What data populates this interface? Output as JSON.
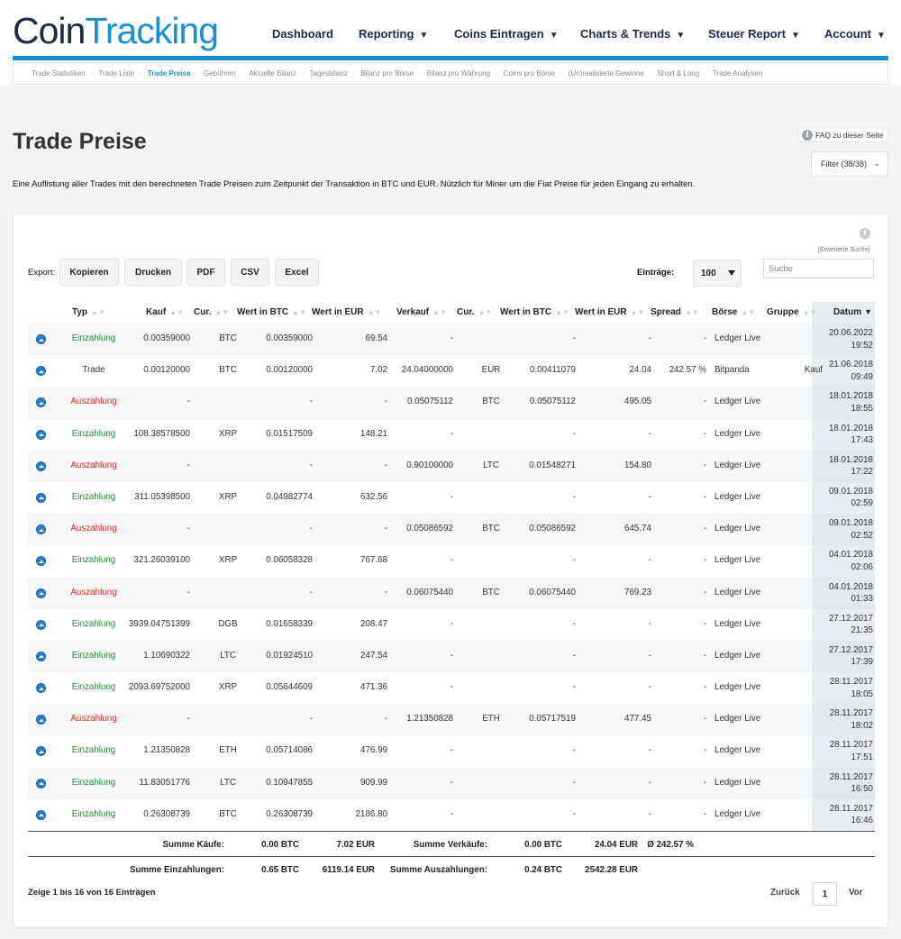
{
  "logo": {
    "part1": "Coin",
    "part2": "Tracking"
  },
  "nav": [
    {
      "label": "Dashboard",
      "caret": ""
    },
    {
      "label": "Reporting",
      "caret": "▼"
    },
    {
      "label": "Coins Eintragen",
      "caret": "▼"
    },
    {
      "label": "Charts & Trends",
      "caret": "▼"
    },
    {
      "label": "Steuer Report",
      "caret": "▼"
    },
    {
      "label": "Account",
      "caret": "▼"
    }
  ],
  "subnav": [
    "Trade Statistiken",
    "Trade Liste",
    "Trade Preise",
    "Gebühren",
    "Aktuelle Bilanz",
    "Tagesbilanz",
    "Bilanz pro Börse",
    "Bilanz pro Währung",
    "Coins pro Börse",
    "(Un)realisierte Gewinne",
    "Short & Long",
    "Trade Analysen"
  ],
  "subnav_active": "Trade Preise",
  "page": {
    "title": "Trade Preise",
    "faq": "FAQ zu dieser Seite",
    "filter": "Filter (38/38)",
    "description": "Eine Auflistung aller Trades mit den berechneten Trade Preisen zum Zeitpunkt der Transaktion in BTC und EUR. Nützlich für Miner um die Fiat Preise für jeden Eingang zu erhalten."
  },
  "toolbar": {
    "export_label": "Export:",
    "buttons": [
      "Kopieren",
      "Drucken",
      "PDF",
      "CSV",
      "Excel"
    ],
    "entries_label": "Einträge:",
    "entries_value": "100",
    "adv_search": "[Erweiterte Suche]",
    "search_placeholder": "Suche"
  },
  "table": {
    "headers": [
      "Typ",
      "Kauf",
      "Cur.",
      "Wert in BTC",
      "Wert in EUR",
      "Verkauf",
      "Cur.",
      "Wert in BTC",
      "Wert in EUR",
      "Spread",
      "Börse",
      "Gruppe",
      "Datum"
    ],
    "rows": [
      {
        "typ": "Einzahlung",
        "kind": "in",
        "kauf": "0.00359000",
        "kcur": "BTC",
        "kbtc": "0.00359000",
        "keur": "69.54",
        "verkauf": "-",
        "vcur": "",
        "vbtc": "-",
        "veur": "-",
        "spread": "-",
        "boerse": "Ledger Live",
        "gruppe": "",
        "date": "20.06.2022",
        "time": "19:52"
      },
      {
        "typ": "Trade",
        "kind": "trade",
        "kauf": "0.00120000",
        "kcur": "BTC",
        "kbtc": "0.00120000",
        "keur": "7.02",
        "verkauf": "24.04000000",
        "vcur": "EUR",
        "vbtc": "0.00411079",
        "veur": "24.04",
        "spread": "242.57 %",
        "boerse": "Bitpanda",
        "gruppe": "Kauf",
        "date": "21.06.2018",
        "time": "09:49"
      },
      {
        "typ": "Auszahlung",
        "kind": "out",
        "kauf": "-",
        "kcur": "",
        "kbtc": "-",
        "keur": "-",
        "verkauf": "0.05075112",
        "vcur": "BTC",
        "vbtc": "0.05075112",
        "veur": "495.05",
        "spread": "-",
        "boerse": "Ledger Live",
        "gruppe": "",
        "date": "18.01.2018",
        "time": "18:55"
      },
      {
        "typ": "Einzahlung",
        "kind": "in",
        "kauf": "108.38578500",
        "kcur": "XRP",
        "kbtc": "0.01517509",
        "keur": "148.21",
        "verkauf": "-",
        "vcur": "",
        "vbtc": "-",
        "veur": "-",
        "spread": "-",
        "boerse": "Ledger Live",
        "gruppe": "",
        "date": "18.01.2018",
        "time": "17:43"
      },
      {
        "typ": "Auszahlung",
        "kind": "out",
        "kauf": "-",
        "kcur": "",
        "kbtc": "-",
        "keur": "-",
        "verkauf": "0.90100000",
        "vcur": "LTC",
        "vbtc": "0.01548271",
        "veur": "154.80",
        "spread": "-",
        "boerse": "Ledger Live",
        "gruppe": "",
        "date": "18.01.2018",
        "time": "17:22"
      },
      {
        "typ": "Einzahlung",
        "kind": "in",
        "kauf": "311.05398500",
        "kcur": "XRP",
        "kbtc": "0.04982774",
        "keur": "632.56",
        "verkauf": "-",
        "vcur": "",
        "vbtc": "-",
        "veur": "-",
        "spread": "-",
        "boerse": "Ledger Live",
        "gruppe": "",
        "date": "09.01.2018",
        "time": "02:59"
      },
      {
        "typ": "Auszahlung",
        "kind": "out",
        "kauf": "-",
        "kcur": "",
        "kbtc": "-",
        "keur": "-",
        "verkauf": "0.05086592",
        "vcur": "BTC",
        "vbtc": "0.05086592",
        "veur": "645.74",
        "spread": "-",
        "boerse": "Ledger Live",
        "gruppe": "",
        "date": "09.01.2018",
        "time": "02:52"
      },
      {
        "typ": "Einzahlung",
        "kind": "in",
        "kauf": "321.26039100",
        "kcur": "XRP",
        "kbtc": "0.06058328",
        "keur": "767.68",
        "verkauf": "-",
        "vcur": "",
        "vbtc": "-",
        "veur": "-",
        "spread": "-",
        "boerse": "Ledger Live",
        "gruppe": "",
        "date": "04.01.2018",
        "time": "02:06"
      },
      {
        "typ": "Auszahlung",
        "kind": "out",
        "kauf": "-",
        "kcur": "",
        "kbtc": "-",
        "keur": "-",
        "verkauf": "0.06075440",
        "vcur": "BTC",
        "vbtc": "0.06075440",
        "veur": "769.23",
        "spread": "-",
        "boerse": "Ledger Live",
        "gruppe": "",
        "date": "04.01.2018",
        "time": "01:33"
      },
      {
        "typ": "Einzahlung",
        "kind": "in",
        "kauf": "3939.04751399",
        "kcur": "DGB",
        "kbtc": "0.01658339",
        "keur": "208.47",
        "verkauf": "-",
        "vcur": "",
        "vbtc": "-",
        "veur": "-",
        "spread": "-",
        "boerse": "Ledger Live",
        "gruppe": "",
        "date": "27.12.2017",
        "time": "21:35"
      },
      {
        "typ": "Einzahlung",
        "kind": "in",
        "kauf": "1.10690322",
        "kcur": "LTC",
        "kbtc": "0.01924510",
        "keur": "247.54",
        "verkauf": "-",
        "vcur": "",
        "vbtc": "-",
        "veur": "-",
        "spread": "-",
        "boerse": "Ledger Live",
        "gruppe": "",
        "date": "27.12.2017",
        "time": "17:39"
      },
      {
        "typ": "Einzahlung",
        "kind": "in",
        "kauf": "2093.69752000",
        "kcur": "XRP",
        "kbtc": "0.05644609",
        "keur": "471.36",
        "verkauf": "-",
        "vcur": "",
        "vbtc": "-",
        "veur": "-",
        "spread": "-",
        "boerse": "Ledger Live",
        "gruppe": "",
        "date": "28.11.2017",
        "time": "18:05"
      },
      {
        "typ": "Auszahlung",
        "kind": "out",
        "kauf": "-",
        "kcur": "",
        "kbtc": "-",
        "keur": "-",
        "verkauf": "1.21350828",
        "vcur": "ETH",
        "vbtc": "0.05717519",
        "veur": "477.45",
        "spread": "-",
        "boerse": "Ledger Live",
        "gruppe": "",
        "date": "28.11.2017",
        "time": "18:02"
      },
      {
        "typ": "Einzahlung",
        "kind": "in",
        "kauf": "1.21350828",
        "kcur": "ETH",
        "kbtc": "0.05714086",
        "keur": "476.99",
        "verkauf": "-",
        "vcur": "",
        "vbtc": "-",
        "veur": "-",
        "spread": "-",
        "boerse": "Ledger Live",
        "gruppe": "",
        "date": "28.11.2017",
        "time": "17:51"
      },
      {
        "typ": "Einzahlung",
        "kind": "in",
        "kauf": "11.83051776",
        "kcur": "LTC",
        "kbtc": "0.10947855",
        "keur": "909.99",
        "verkauf": "-",
        "vcur": "",
        "vbtc": "-",
        "veur": "-",
        "spread": "-",
        "boerse": "Ledger Live",
        "gruppe": "",
        "date": "28.11.2017",
        "time": "16:50"
      },
      {
        "typ": "Einzahlung",
        "kind": "in",
        "kauf": "0.26308739",
        "kcur": "BTC",
        "kbtc": "0.26308739",
        "keur": "2186.80",
        "verkauf": "-",
        "vcur": "",
        "vbtc": "-",
        "veur": "-",
        "spread": "-",
        "boerse": "Ledger Live",
        "gruppe": "",
        "date": "28.11.2017",
        "time": "16:46"
      }
    ]
  },
  "summary": {
    "kauf_label": "Summe Käufe:",
    "kauf_btc": "0.00 BTC",
    "kauf_eur": "7.02 EUR",
    "verkauf_label": "Summe Verkäufe:",
    "verkauf_btc": "0.00 BTC",
    "verkauf_eur": "24.04 EUR",
    "spread": "Ø 242.57 %",
    "ein_label": "Summe Einzahlungen:",
    "ein_btc": "0.65 BTC",
    "ein_eur": "6119.14 EUR",
    "aus_label": "Summe Auszahlungen:",
    "aus_btc": "0.24 BTC",
    "aus_eur": "2542.28 EUR"
  },
  "footer": {
    "showing": "Zeige 1 bis 16 von 16 Einträgen",
    "prev": "Zurück",
    "current": "1",
    "next": "Vor"
  },
  "colors": {
    "brand_blue": "#1b8fd3",
    "brand_dark": "#1c2b4a",
    "deposit": "#1a8f2e",
    "withdrawal": "#e0241b"
  }
}
